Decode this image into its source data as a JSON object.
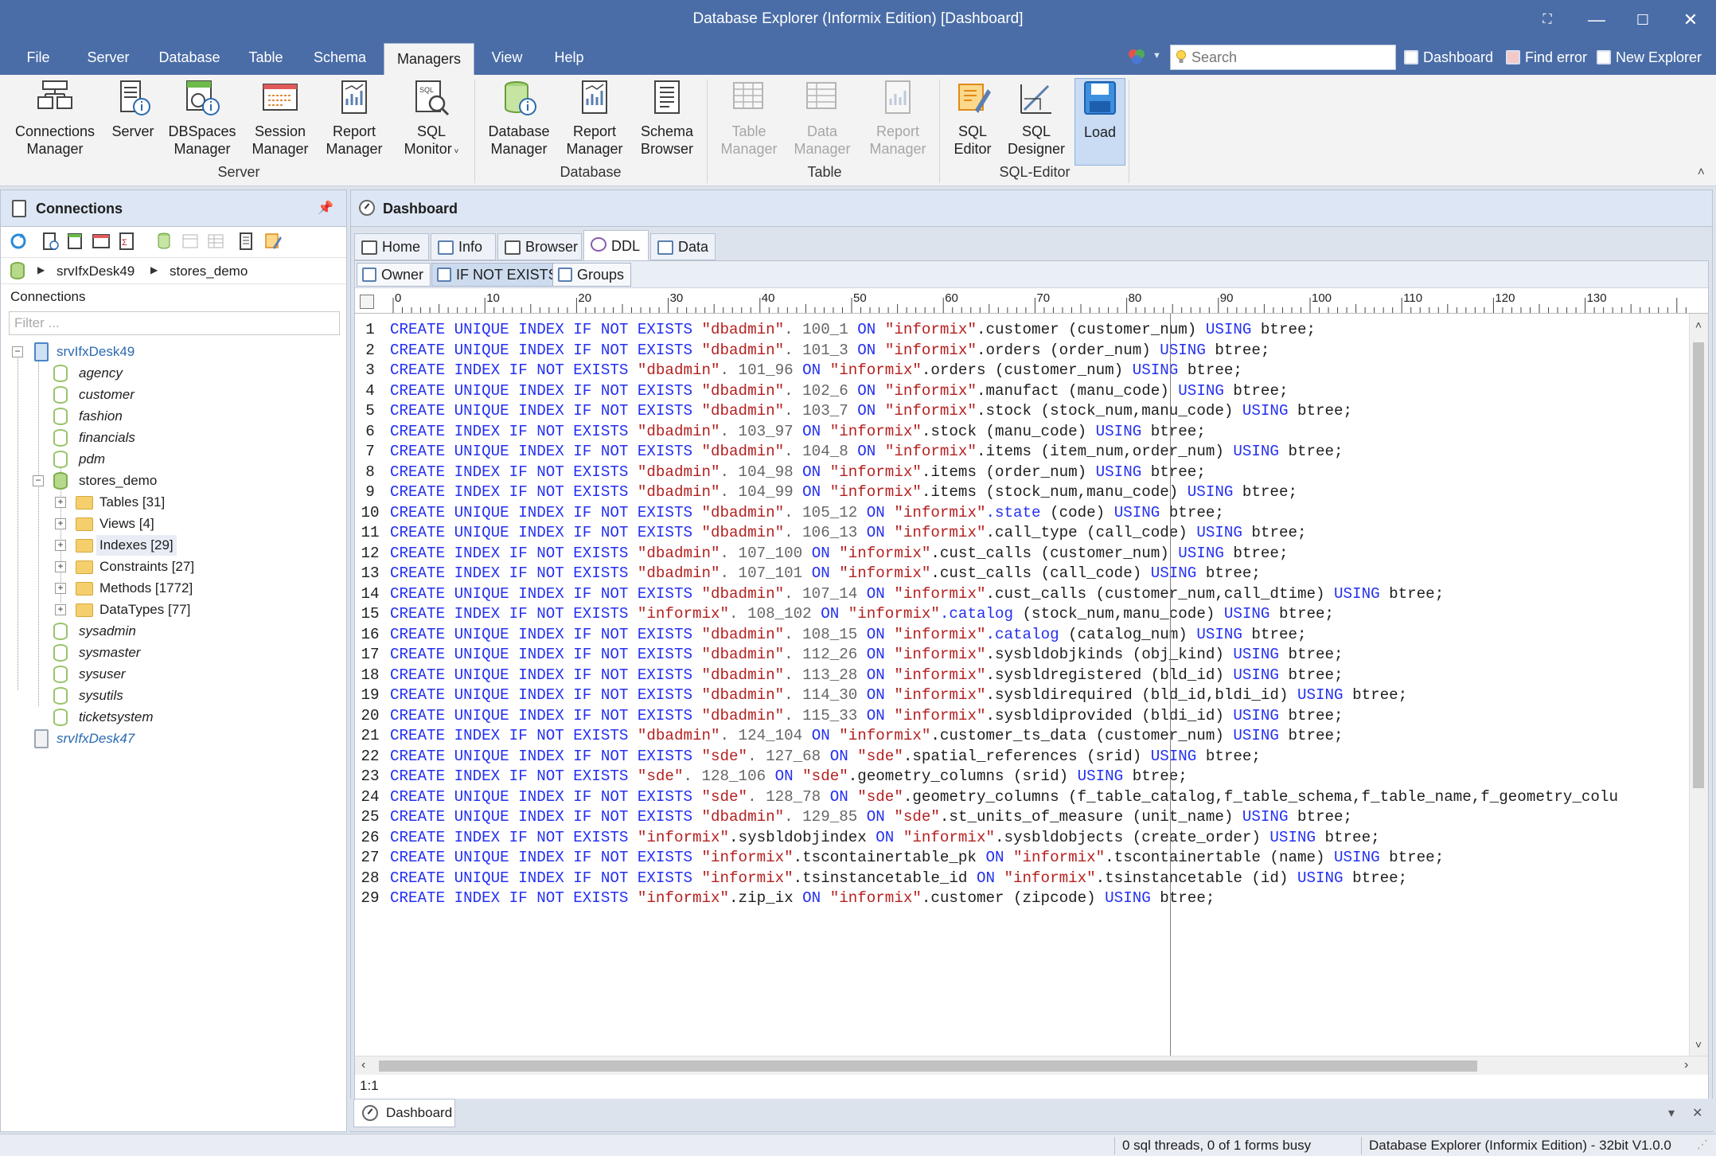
{
  "window": {
    "title": "Database Explorer (Informix Edition) [Dashboard]",
    "controls": [
      "fullscreen",
      "minimize",
      "maximize",
      "close"
    ]
  },
  "menu": {
    "items": [
      "File",
      "Server",
      "Database",
      "Table",
      "Schema",
      "Managers",
      "View",
      "Help"
    ],
    "active": "Managers",
    "search_placeholder": "Search",
    "quick_links": [
      "Dashboard",
      "Find error",
      "New Explorer"
    ]
  },
  "ribbon": {
    "buttons": [
      {
        "label1": "Connections",
        "label2": "Manager",
        "icon": "connections-manager-icon",
        "enabled": true
      },
      {
        "label1": "Server",
        "label2": "",
        "icon": "server-info-icon",
        "enabled": true
      },
      {
        "label1": "DBSpaces",
        "label2": "Manager",
        "icon": "dbspaces-icon",
        "enabled": true
      },
      {
        "label1": "Session",
        "label2": "Manager",
        "icon": "session-icon",
        "enabled": true
      },
      {
        "label1": "Report",
        "label2": "Manager",
        "icon": "report-icon",
        "enabled": true
      },
      {
        "label1": "SQL",
        "label2": "Monitor",
        "icon": "sql-monitor-icon",
        "enabled": true,
        "dropdown": true
      },
      {
        "label1": "Database",
        "label2": "Manager",
        "icon": "database-manager-icon",
        "enabled": true
      },
      {
        "label1": "Report",
        "label2": "Manager",
        "icon": "report-icon",
        "enabled": true
      },
      {
        "label1": "Schema",
        "label2": "Browser",
        "icon": "schema-browser-icon",
        "enabled": true
      },
      {
        "label1": "Table",
        "label2": "Manager",
        "icon": "table-manager-icon",
        "enabled": false
      },
      {
        "label1": "Data",
        "label2": "Manager",
        "icon": "data-manager-icon",
        "enabled": false
      },
      {
        "label1": "Report",
        "label2": "Manager",
        "icon": "report-icon",
        "enabled": false
      },
      {
        "label1": "SQL",
        "label2": "Editor",
        "icon": "sql-editor-icon",
        "enabled": true
      },
      {
        "label1": "SQL",
        "label2": "Designer",
        "icon": "sql-designer-icon",
        "enabled": true
      },
      {
        "label1": "Load",
        "label2": "",
        "icon": "load-icon",
        "enabled": true,
        "selected": true
      }
    ],
    "groups": [
      "Server",
      "Database",
      "Table",
      "SQL-Editor"
    ]
  },
  "connections_panel": {
    "title": "Connections",
    "breadcrumb": [
      "srvIfxDesk49",
      "stores_demo"
    ],
    "list_label": "Connections",
    "filter_placeholder": "Filter ...",
    "tree": {
      "server1": "srvIfxDesk49",
      "databases_top": [
        "agency",
        "customer",
        "fashion",
        "financials",
        "pdm"
      ],
      "current_db": "stores_demo",
      "folders": [
        "Tables [31]",
        "Views [4]",
        "Indexes [29]",
        "Constraints [27]",
        "Methods [1772]",
        "DataTypes [77]"
      ],
      "databases_bottom": [
        "sysadmin",
        "sysmaster",
        "sysuser",
        "sysutils",
        "ticketsystem"
      ],
      "server2": "srvIfxDesk47"
    }
  },
  "dashboard": {
    "title": "Dashboard",
    "tabs": [
      "Home",
      "Info",
      "Browser",
      "DDL",
      "Data"
    ],
    "active_tab": "DDL",
    "subtoolbar": [
      "Owner",
      "IF NOT EXISTS",
      "Groups"
    ],
    "ruler_labels": [
      "0",
      "10",
      "20",
      "30",
      "40",
      "50",
      "60",
      "70",
      "80",
      "90",
      "100",
      "110",
      "120",
      "130"
    ],
    "cursor_position": "1:1",
    "bottom_tab": "Dashboard"
  },
  "ddl_lines": [
    [
      [
        "k",
        "CREATE UNIQUE INDEX IF NOT EXISTS "
      ],
      [
        "s",
        "\"dbadmin\""
      ],
      [
        "n",
        ". 100_1 "
      ],
      [
        "k",
        "ON "
      ],
      [
        "s",
        "\"informix\""
      ],
      [
        "i",
        ".customer (customer_num) "
      ],
      [
        "k",
        "USING "
      ],
      [
        "i",
        "btree;"
      ]
    ],
    [
      [
        "k",
        "CREATE UNIQUE INDEX IF NOT EXISTS "
      ],
      [
        "s",
        "\"dbadmin\""
      ],
      [
        "n",
        ". 101_3 "
      ],
      [
        "k",
        "ON "
      ],
      [
        "s",
        "\"informix\""
      ],
      [
        "i",
        ".orders (order_num) "
      ],
      [
        "k",
        "USING "
      ],
      [
        "i",
        "btree;"
      ]
    ],
    [
      [
        "k",
        "CREATE INDEX IF NOT EXISTS "
      ],
      [
        "s",
        "\"dbadmin\""
      ],
      [
        "n",
        ". 101_96 "
      ],
      [
        "k",
        "ON "
      ],
      [
        "s",
        "\"informix\""
      ],
      [
        "i",
        ".orders (customer_num) "
      ],
      [
        "k",
        "USING "
      ],
      [
        "i",
        "btree;"
      ]
    ],
    [
      [
        "k",
        "CREATE UNIQUE INDEX IF NOT EXISTS "
      ],
      [
        "s",
        "\"dbadmin\""
      ],
      [
        "n",
        ". 102_6 "
      ],
      [
        "k",
        "ON "
      ],
      [
        "s",
        "\"informix\""
      ],
      [
        "i",
        ".manufact (manu_code) "
      ],
      [
        "k",
        "USING "
      ],
      [
        "i",
        "btree;"
      ]
    ],
    [
      [
        "k",
        "CREATE UNIQUE INDEX IF NOT EXISTS "
      ],
      [
        "s",
        "\"dbadmin\""
      ],
      [
        "n",
        ". 103_7 "
      ],
      [
        "k",
        "ON "
      ],
      [
        "s",
        "\"informix\""
      ],
      [
        "i",
        ".stock (stock_num,manu_code) "
      ],
      [
        "k",
        "USING "
      ],
      [
        "i",
        "btree;"
      ]
    ],
    [
      [
        "k",
        "CREATE INDEX IF NOT EXISTS "
      ],
      [
        "s",
        "\"dbadmin\""
      ],
      [
        "n",
        ". 103_97 "
      ],
      [
        "k",
        "ON "
      ],
      [
        "s",
        "\"informix\""
      ],
      [
        "i",
        ".stock (manu_code) "
      ],
      [
        "k",
        "USING "
      ],
      [
        "i",
        "btree;"
      ]
    ],
    [
      [
        "k",
        "CREATE UNIQUE INDEX IF NOT EXISTS "
      ],
      [
        "s",
        "\"dbadmin\""
      ],
      [
        "n",
        ". 104_8 "
      ],
      [
        "k",
        "ON "
      ],
      [
        "s",
        "\"informix\""
      ],
      [
        "i",
        ".items (item_num,order_num) "
      ],
      [
        "k",
        "USING "
      ],
      [
        "i",
        "btree;"
      ]
    ],
    [
      [
        "k",
        "CREATE INDEX IF NOT EXISTS "
      ],
      [
        "s",
        "\"dbadmin\""
      ],
      [
        "n",
        ". 104_98 "
      ],
      [
        "k",
        "ON "
      ],
      [
        "s",
        "\"informix\""
      ],
      [
        "i",
        ".items (order_num) "
      ],
      [
        "k",
        "USING "
      ],
      [
        "i",
        "btree;"
      ]
    ],
    [
      [
        "k",
        "CREATE INDEX IF NOT EXISTS "
      ],
      [
        "s",
        "\"dbadmin\""
      ],
      [
        "n",
        ". 104_99 "
      ],
      [
        "k",
        "ON "
      ],
      [
        "s",
        "\"informix\""
      ],
      [
        "i",
        ".items (stock_num,manu_code) "
      ],
      [
        "k",
        "USING "
      ],
      [
        "i",
        "btree;"
      ]
    ],
    [
      [
        "k",
        "CREATE UNIQUE INDEX IF NOT EXISTS "
      ],
      [
        "s",
        "\"dbadmin\""
      ],
      [
        "n",
        ". 105_12 "
      ],
      [
        "k",
        "ON "
      ],
      [
        "s",
        "\"informix\""
      ],
      [
        "k",
        ".state "
      ],
      [
        "i",
        "(code) "
      ],
      [
        "k",
        "USING "
      ],
      [
        "i",
        "btree;"
      ]
    ],
    [
      [
        "k",
        "CREATE UNIQUE INDEX IF NOT EXISTS "
      ],
      [
        "s",
        "\"dbadmin\""
      ],
      [
        "n",
        ". 106_13 "
      ],
      [
        "k",
        "ON "
      ],
      [
        "s",
        "\"informix\""
      ],
      [
        "i",
        ".call_type (call_code) "
      ],
      [
        "k",
        "USING "
      ],
      [
        "i",
        "btree;"
      ]
    ],
    [
      [
        "k",
        "CREATE INDEX IF NOT EXISTS "
      ],
      [
        "s",
        "\"dbadmin\""
      ],
      [
        "n",
        ". 107_100 "
      ],
      [
        "k",
        "ON "
      ],
      [
        "s",
        "\"informix\""
      ],
      [
        "i",
        ".cust_calls (customer_num) "
      ],
      [
        "k",
        "USING "
      ],
      [
        "i",
        "btree;"
      ]
    ],
    [
      [
        "k",
        "CREATE INDEX IF NOT EXISTS "
      ],
      [
        "s",
        "\"dbadmin\""
      ],
      [
        "n",
        ". 107_101 "
      ],
      [
        "k",
        "ON "
      ],
      [
        "s",
        "\"informix\""
      ],
      [
        "i",
        ".cust_calls (call_code) "
      ],
      [
        "k",
        "USING "
      ],
      [
        "i",
        "btree;"
      ]
    ],
    [
      [
        "k",
        "CREATE UNIQUE INDEX IF NOT EXISTS "
      ],
      [
        "s",
        "\"dbadmin\""
      ],
      [
        "n",
        ". 107_14 "
      ],
      [
        "k",
        "ON "
      ],
      [
        "s",
        "\"informix\""
      ],
      [
        "i",
        ".cust_calls (customer_num,call_dtime) "
      ],
      [
        "k",
        "USING "
      ],
      [
        "i",
        "btree;"
      ]
    ],
    [
      [
        "k",
        "CREATE INDEX IF NOT EXISTS "
      ],
      [
        "s",
        "\"informix\""
      ],
      [
        "n",
        ". 108_102 "
      ],
      [
        "k",
        "ON "
      ],
      [
        "s",
        "\"informix\""
      ],
      [
        "k",
        ".catalog "
      ],
      [
        "i",
        "(stock_num,manu_code) "
      ],
      [
        "k",
        "USING "
      ],
      [
        "i",
        "btree;"
      ]
    ],
    [
      [
        "k",
        "CREATE UNIQUE INDEX IF NOT EXISTS "
      ],
      [
        "s",
        "\"dbadmin\""
      ],
      [
        "n",
        ". 108_15 "
      ],
      [
        "k",
        "ON "
      ],
      [
        "s",
        "\"informix\""
      ],
      [
        "k",
        ".catalog "
      ],
      [
        "i",
        "(catalog_num) "
      ],
      [
        "k",
        "USING "
      ],
      [
        "i",
        "btree;"
      ]
    ],
    [
      [
        "k",
        "CREATE UNIQUE INDEX IF NOT EXISTS "
      ],
      [
        "s",
        "\"dbadmin\""
      ],
      [
        "n",
        ". 112_26 "
      ],
      [
        "k",
        "ON "
      ],
      [
        "s",
        "\"informix\""
      ],
      [
        "i",
        ".sysbldobjkinds (obj_kind) "
      ],
      [
        "k",
        "USING "
      ],
      [
        "i",
        "btree;"
      ]
    ],
    [
      [
        "k",
        "CREATE UNIQUE INDEX IF NOT EXISTS "
      ],
      [
        "s",
        "\"dbadmin\""
      ],
      [
        "n",
        ". 113_28 "
      ],
      [
        "k",
        "ON "
      ],
      [
        "s",
        "\"informix\""
      ],
      [
        "i",
        ".sysbldregistered (bld_id) "
      ],
      [
        "k",
        "USING "
      ],
      [
        "i",
        "btree;"
      ]
    ],
    [
      [
        "k",
        "CREATE UNIQUE INDEX IF NOT EXISTS "
      ],
      [
        "s",
        "\"dbadmin\""
      ],
      [
        "n",
        ". 114_30 "
      ],
      [
        "k",
        "ON "
      ],
      [
        "s",
        "\"informix\""
      ],
      [
        "i",
        ".sysbldirequired (bld_id,bldi_id) "
      ],
      [
        "k",
        "USING "
      ],
      [
        "i",
        "btree;"
      ]
    ],
    [
      [
        "k",
        "CREATE UNIQUE INDEX IF NOT EXISTS "
      ],
      [
        "s",
        "\"dbadmin\""
      ],
      [
        "n",
        ". 115_33 "
      ],
      [
        "k",
        "ON "
      ],
      [
        "s",
        "\"informix\""
      ],
      [
        "i",
        ".sysbldiprovided (bldi_id) "
      ],
      [
        "k",
        "USING "
      ],
      [
        "i",
        "btree;"
      ]
    ],
    [
      [
        "k",
        "CREATE INDEX IF NOT EXISTS "
      ],
      [
        "s",
        "\"dbadmin\""
      ],
      [
        "n",
        ". 124_104 "
      ],
      [
        "k",
        "ON "
      ],
      [
        "s",
        "\"informix\""
      ],
      [
        "i",
        ".customer_ts_data (customer_num) "
      ],
      [
        "k",
        "USING "
      ],
      [
        "i",
        "btree;"
      ]
    ],
    [
      [
        "k",
        "CREATE UNIQUE INDEX IF NOT EXISTS "
      ],
      [
        "s",
        "\"sde\""
      ],
      [
        "n",
        ". 127_68 "
      ],
      [
        "k",
        "ON "
      ],
      [
        "s",
        "\"sde\""
      ],
      [
        "i",
        ".spatial_references (srid) "
      ],
      [
        "k",
        "USING "
      ],
      [
        "i",
        "btree;"
      ]
    ],
    [
      [
        "k",
        "CREATE INDEX IF NOT EXISTS "
      ],
      [
        "s",
        "\"sde\""
      ],
      [
        "n",
        ". 128_106 "
      ],
      [
        "k",
        "ON "
      ],
      [
        "s",
        "\"sde\""
      ],
      [
        "i",
        ".geometry_columns (srid) "
      ],
      [
        "k",
        "USING "
      ],
      [
        "i",
        "btree;"
      ]
    ],
    [
      [
        "k",
        "CREATE UNIQUE INDEX IF NOT EXISTS "
      ],
      [
        "s",
        "\"sde\""
      ],
      [
        "n",
        ". 128_78 "
      ],
      [
        "k",
        "ON "
      ],
      [
        "s",
        "\"sde\""
      ],
      [
        "i",
        ".geometry_columns (f_table_catalog,f_table_schema,f_table_name,f_geometry_colu"
      ]
    ],
    [
      [
        "k",
        "CREATE UNIQUE INDEX IF NOT EXISTS "
      ],
      [
        "s",
        "\"dbadmin\""
      ],
      [
        "n",
        ". 129_85 "
      ],
      [
        "k",
        "ON "
      ],
      [
        "s",
        "\"sde\""
      ],
      [
        "i",
        ".st_units_of_measure (unit_name) "
      ],
      [
        "k",
        "USING "
      ],
      [
        "i",
        "btree;"
      ]
    ],
    [
      [
        "k",
        "CREATE INDEX IF NOT EXISTS "
      ],
      [
        "s",
        "\"informix\""
      ],
      [
        "i",
        ".sysbldobjindex "
      ],
      [
        "k",
        "ON "
      ],
      [
        "s",
        "\"informix\""
      ],
      [
        "i",
        ".sysbldobjects (create_order) "
      ],
      [
        "k",
        "USING "
      ],
      [
        "i",
        "btree;"
      ]
    ],
    [
      [
        "k",
        "CREATE UNIQUE INDEX IF NOT EXISTS "
      ],
      [
        "s",
        "\"informix\""
      ],
      [
        "i",
        ".tscontainertable_pk "
      ],
      [
        "k",
        "ON "
      ],
      [
        "s",
        "\"informix\""
      ],
      [
        "i",
        ".tscontainertable (name) "
      ],
      [
        "k",
        "USING "
      ],
      [
        "i",
        "btree;"
      ]
    ],
    [
      [
        "k",
        "CREATE UNIQUE INDEX IF NOT EXISTS "
      ],
      [
        "s",
        "\"informix\""
      ],
      [
        "i",
        ".tsinstancetable_id "
      ],
      [
        "k",
        "ON "
      ],
      [
        "s",
        "\"informix\""
      ],
      [
        "i",
        ".tsinstancetable (id) "
      ],
      [
        "k",
        "USING "
      ],
      [
        "i",
        "btree;"
      ]
    ],
    [
      [
        "k",
        "CREATE INDEX IF NOT EXISTS "
      ],
      [
        "s",
        "\"informix\""
      ],
      [
        "i",
        ".zip_ix "
      ],
      [
        "k",
        "ON "
      ],
      [
        "s",
        "\"informix\""
      ],
      [
        "i",
        ".customer (zipcode) "
      ],
      [
        "k",
        "USING "
      ],
      [
        "i",
        "btree;"
      ]
    ]
  ],
  "status": {
    "threads": "0 sql threads, 0 of 1 forms busy",
    "product": "Database Explorer (Informix Edition) - 32bit V1.0.0"
  },
  "colors": {
    "titlebar": "#4a6da7",
    "keyword": "#2430f0",
    "string": "#b52020"
  }
}
